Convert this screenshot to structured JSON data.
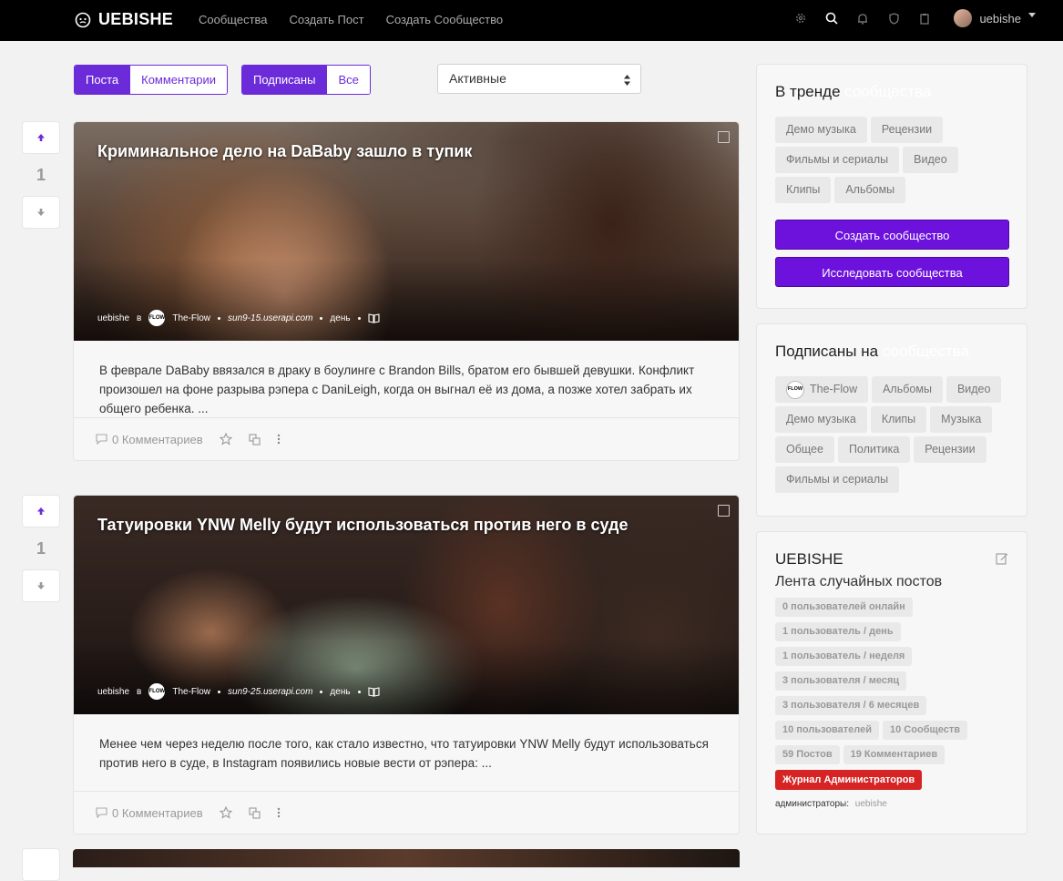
{
  "navbar": {
    "brand": "UEBISHE",
    "links": [
      "Сообщества",
      "Создать Пост",
      "Создать Сообщество"
    ],
    "username": "uebishe"
  },
  "filters": {
    "type": [
      "Поста",
      "Комментарии"
    ],
    "scope": [
      "Подписаны",
      "Все"
    ],
    "sort_selected": "Активные"
  },
  "posts": [
    {
      "score": "1",
      "title": "Криминальное дело на DaBaby зашло в тупик",
      "author": "uebishe",
      "in": "в",
      "community": "The-Flow",
      "community_icon_text": "FLOW",
      "domain": "sun9-15.userapi.com",
      "time": "день",
      "excerpt": "В феврале DaBaby ввязался в драку в боулинге с Brandon Bills, братом его бывшей девушки. Конфликт произошел на фоне разрыва рэпера с DaniLeigh, когда он выгнал её из дома, а позже хотел забрать их общего ребенка. ...",
      "comments": "0 Комментариев"
    },
    {
      "score": "1",
      "title": "Татуировки YNW Melly будут использоваться против него в суде",
      "author": "uebishe",
      "in": "в",
      "community": "The-Flow",
      "community_icon_text": "FLOW",
      "domain": "sun9-25.userapi.com",
      "time": "день",
      "excerpt": "Менее чем через неделю после того, как стало известно, что татуировки YNW Melly будут использоваться против него в суде, в Instagram появились новые вести от рэпера: ...",
      "comments": "0 Комментариев"
    }
  ],
  "trending": {
    "title": "В тренде",
    "title_suffix": "сообщества",
    "chips": [
      "Демо музыка",
      "Рецензии",
      "Фильмы и сериалы",
      "Видео",
      "Клипы",
      "Альбомы"
    ],
    "create_button": "Создать сообщество",
    "explore_button": "Исследовать сообщества"
  },
  "subscribed": {
    "title": "Подписаны на",
    "title_suffix": "сообщества",
    "chips": [
      "The-Flow",
      "Альбомы",
      "Видео",
      "Демо музыка",
      "Клипы",
      "Музыка",
      "Общее",
      "Политика",
      "Рецензии",
      "Фильмы и сериалы"
    ]
  },
  "site": {
    "name": "UEBISHE",
    "description": "Лента случайных постов",
    "stats": {
      "online": "0 пользователей онлайн",
      "day": "1 пользователь / день",
      "week": "1 пользователь / неделя",
      "month": "3 пользователя / месяц",
      "half_year": "3 пользователя / 6 месяцев",
      "users": "10 пользователей",
      "communities": "10 Сообществ",
      "posts": "59 Постов",
      "comments": "19 Комментариев"
    },
    "modlog": "Журнал Администраторов",
    "admins_label": "администраторы:",
    "admins_name": "uebishe"
  },
  "colors": {
    "accent": "#6c2bd9",
    "danger": "#d62424",
    "navbar": "#000000"
  }
}
